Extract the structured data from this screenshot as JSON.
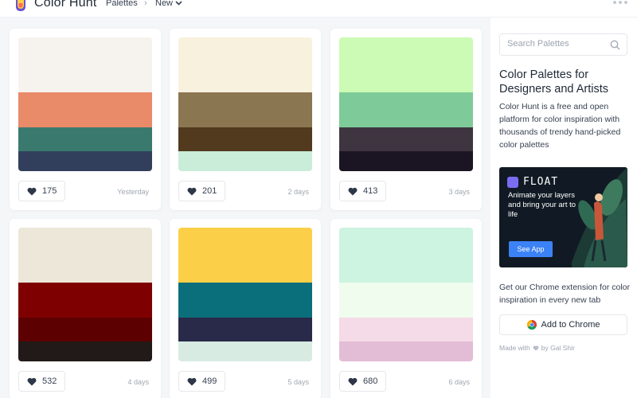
{
  "header": {
    "brand": "Color Hunt",
    "nav_palettes": "Palettes",
    "nav_separator": "›",
    "nav_new": "New"
  },
  "palettes": [
    {
      "likes": "175",
      "date": "Yesterday",
      "colors": [
        "#f6f2ee",
        "#e98a68",
        "#3a7a6e",
        "#323f5c"
      ]
    },
    {
      "likes": "201",
      "date": "2 days",
      "colors": [
        "#f8f1de",
        "#8b7652",
        "#513a1e",
        "#c9edd9"
      ]
    },
    {
      "likes": "413",
      "date": "3 days",
      "colors": [
        "#cbfbb4",
        "#7ecb99",
        "#3e3541",
        "#1b1523"
      ]
    },
    {
      "likes": "532",
      "date": "4 days",
      "colors": [
        "#ede7da",
        "#7f0000",
        "#5c0002",
        "#211a18"
      ]
    },
    {
      "likes": "499",
      "date": "5 days",
      "colors": [
        "#fbcf48",
        "#0b6e7b",
        "#292a4a",
        "#d8ebe3"
      ]
    },
    {
      "likes": "680",
      "date": "6 days",
      "colors": [
        "#cdf3e1",
        "#effcee",
        "#f5dbe7",
        "#e3bdd6"
      ]
    }
  ],
  "sidebar": {
    "search_placeholder": "Search Palettes",
    "headline": "Color Palettes for Designers and Artists",
    "description": "Color Hunt is a free and open platform for color inspiration with thousands of trendy hand-picked color palettes",
    "ad": {
      "brand": "FLOAT",
      "text": "Animate your layers and bring your art to life",
      "button": "See App"
    },
    "extension_text": "Get our Chrome extension for color inspiration in every new tab",
    "chrome_button": "Add to Chrome",
    "made_with_prefix": "Made with",
    "made_with_suffix": "by Gal Shir"
  },
  "icons": {
    "logo": "color-hunt-logo-icon",
    "dropdown": "chevron-down-icon",
    "more": "more-dots-icon",
    "like": "heart-icon",
    "search": "search-icon",
    "chrome": "chrome-icon"
  },
  "colors": {
    "feed_background": "#f5f6f8",
    "ad_button": "#3b82f6",
    "ad_background": "#111a24"
  }
}
